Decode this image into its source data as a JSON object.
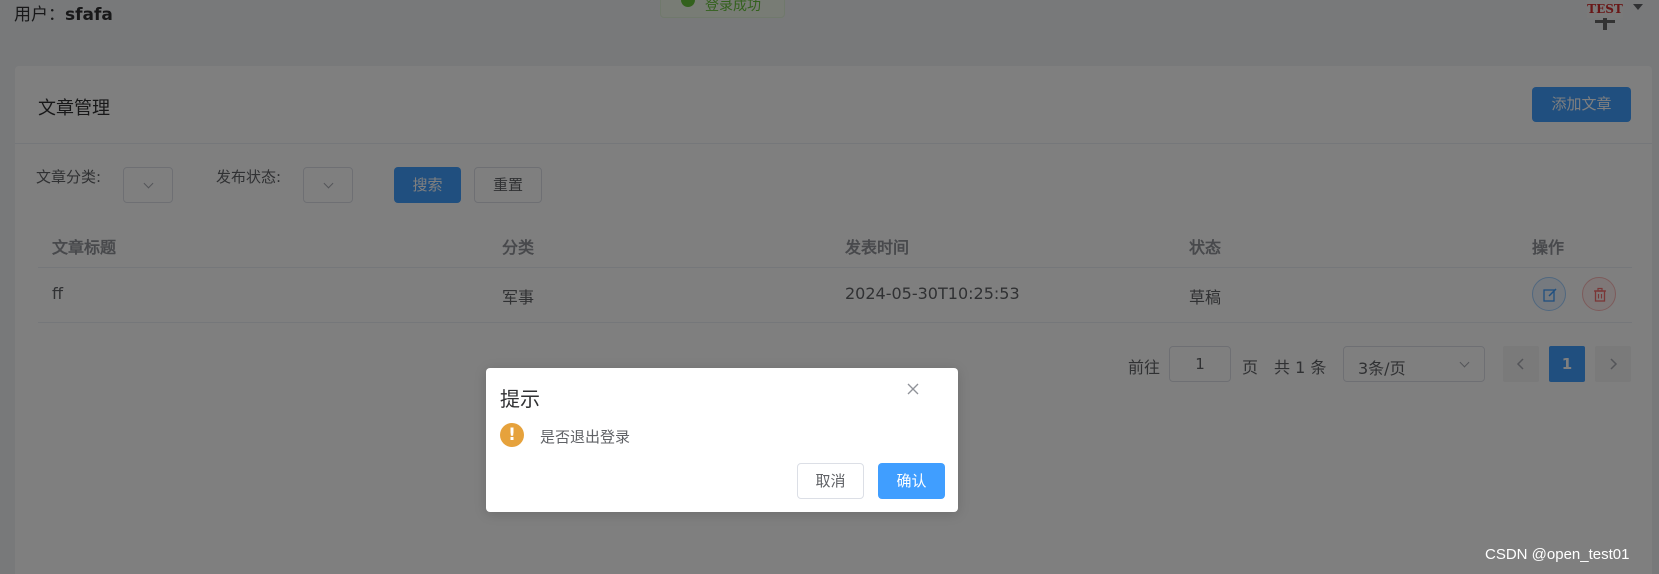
{
  "header": {
    "user_prefix": "用户：",
    "username": "sfafa",
    "toast_text": "登录成功",
    "avatar_text": "TEST"
  },
  "card": {
    "title": "文章管理",
    "add_button": "添加文章"
  },
  "filters": {
    "category_label": "文章分类:",
    "status_label": "发布状态:",
    "search_button": "搜索",
    "reset_button": "重置"
  },
  "table": {
    "headers": [
      "文章标题",
      "分类",
      "发表时间",
      "状态",
      "操作"
    ],
    "rows": [
      {
        "title": "ff",
        "category": "军事",
        "time": "2024-05-30T10:25:53",
        "status": "草稿"
      }
    ]
  },
  "pagination": {
    "goto_label": "前往",
    "page_value": "1",
    "page_unit": "页",
    "total_text": "共 1 条",
    "page_size": "3条/页",
    "current_page": "1"
  },
  "dialog": {
    "title": "提示",
    "message": "是否退出登录",
    "cancel_label": "取消",
    "confirm_label": "确认"
  },
  "watermark": "CSDN @open_test01",
  "colors": {
    "primary": "#409eff",
    "warning": "#e6a23c",
    "danger": "#f56c6c",
    "success": "#67c23a"
  },
  "icons": [
    "edit-icon",
    "delete-icon",
    "close-icon",
    "warning-icon",
    "chevron-down-icon",
    "chevron-left-icon",
    "chevron-right-icon"
  ]
}
